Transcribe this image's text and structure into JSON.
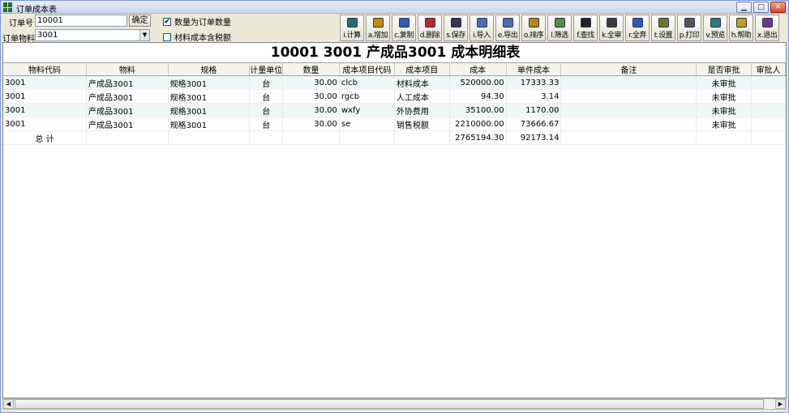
{
  "window": {
    "title": "订单成本表",
    "min": "▁",
    "max": "□",
    "close": "✕"
  },
  "filters": {
    "order_label": "订单号",
    "order_value": "10001",
    "confirm_label": "确定",
    "material_label": "订单物料",
    "material_value": "3001",
    "chk_qty_label": "数量为订单数量",
    "chk_qty_checked": "✔",
    "chk_tax_label": "材料成本含税额"
  },
  "toolbar": [
    {
      "name": "calc-button",
      "label": "i.计算",
      "icon": "calculator-icon",
      "color": "#2a6b6b"
    },
    {
      "name": "add-button",
      "label": "a.增加",
      "icon": "add-icon",
      "color": "#c08a10"
    },
    {
      "name": "copy-button",
      "label": "c.复制",
      "icon": "copy-icon",
      "color": "#2a5db0"
    },
    {
      "name": "delete-button",
      "label": "d.删除",
      "icon": "delete-icon",
      "color": "#b02a2a"
    },
    {
      "name": "save-button",
      "label": "s.保存",
      "icon": "save-icon",
      "color": "#333355"
    },
    {
      "name": "import-button",
      "label": "i.导入",
      "icon": "import-icon",
      "color": "#4a6fb5"
    },
    {
      "name": "export-button",
      "label": "e.导出",
      "icon": "export-icon",
      "color": "#4a6fb5"
    },
    {
      "name": "sort-button",
      "label": "o.排序",
      "icon": "sort-icon",
      "color": "#b08a10"
    },
    {
      "name": "filter-button",
      "label": "l.筛选",
      "icon": "filter-icon",
      "color": "#5a8a3a"
    },
    {
      "name": "find-button",
      "label": "f.查找",
      "icon": "binoculars-icon",
      "color": "#222222"
    },
    {
      "name": "approve-all-button",
      "label": "k.全审",
      "icon": "approve-icon",
      "color": "#3a3a3a"
    },
    {
      "name": "discard-all-button",
      "label": "r.全弃",
      "icon": "undo-icon",
      "color": "#2a5db0"
    },
    {
      "name": "settings-button",
      "label": "t.设置",
      "icon": "settings-icon",
      "color": "#6a7a2a"
    },
    {
      "name": "print-button",
      "label": "p.打印",
      "icon": "printer-icon",
      "color": "#555555"
    },
    {
      "name": "preview-button",
      "label": "v.预览",
      "icon": "preview-icon",
      "color": "#2a7a7a"
    },
    {
      "name": "help-button",
      "label": "h.帮助",
      "icon": "help-icon",
      "color": "#c0a010"
    },
    {
      "name": "exit-button",
      "label": "x.退出",
      "icon": "exit-icon",
      "color": "#6a3a8a"
    }
  ],
  "report": {
    "title": "10001 3001 产成品3001  成本明细表",
    "columns": [
      "物料代码",
      "物料",
      "规格",
      "计量单位",
      "数量",
      "成本项目代码",
      "成本项目",
      "成本",
      "单件成本",
      "备注",
      "是否审批",
      "审批人"
    ],
    "rows": [
      [
        "3001",
        "产成品3001",
        "规格3001",
        "台",
        "30.00",
        "clcb",
        "材料成本",
        "520000.00",
        "17333.33",
        "",
        "未审批",
        ""
      ],
      [
        "3001",
        "产成品3001",
        "规格3001",
        "台",
        "30.00",
        "rgcb",
        "人工成本",
        "94.30",
        "3.14",
        "",
        "未审批",
        ""
      ],
      [
        "3001",
        "产成品3001",
        "规格3001",
        "台",
        "30.00",
        "wxfy",
        "外协费用",
        "35100.00",
        "1170.00",
        "",
        "未审批",
        ""
      ],
      [
        "3001",
        "产成品3001",
        "规格3001",
        "台",
        "30.00",
        "se",
        "销售税额",
        "2210000.00",
        "73666.67",
        "",
        "未审批",
        ""
      ]
    ],
    "total": {
      "label": "总 计",
      "cost": "2765194.30",
      "unit_cost": "92173.14"
    }
  },
  "scrollbar": {
    "left": "◀",
    "right": "▶"
  }
}
